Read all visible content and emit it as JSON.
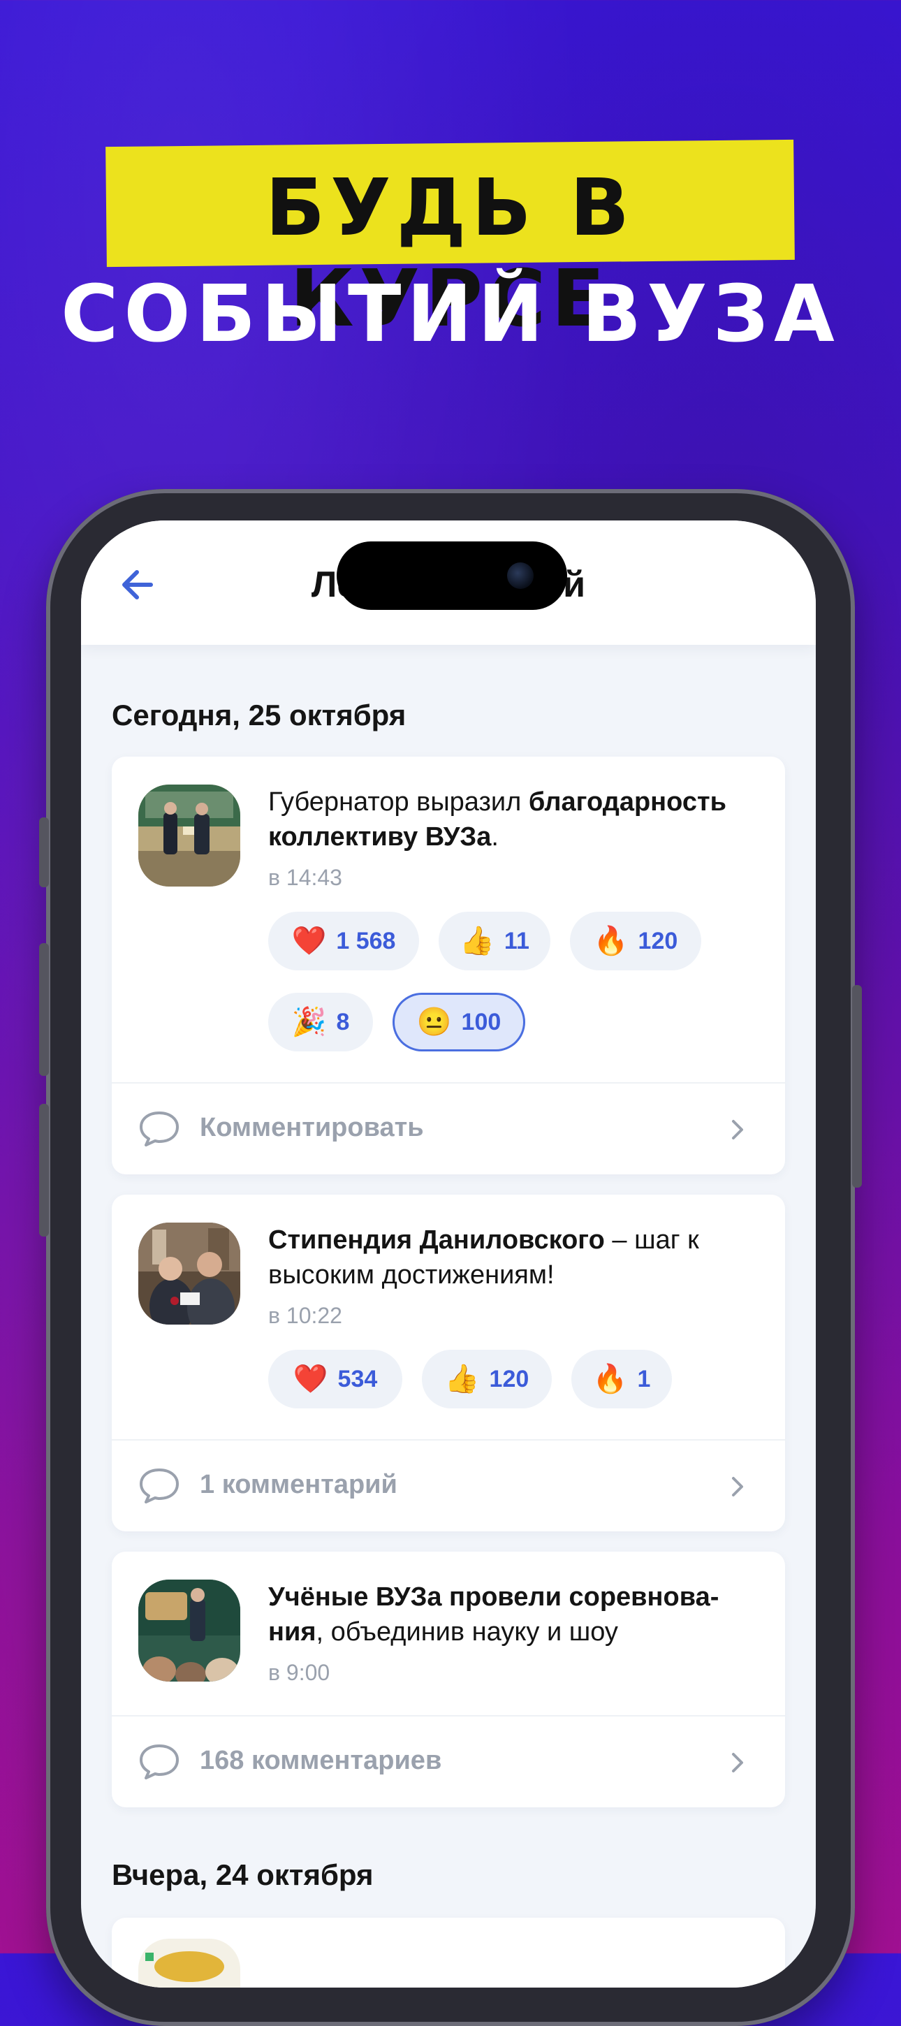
{
  "promo": {
    "line1": "БУДЬ В КУРСЕ",
    "line2": "СОБЫТИЙ ВУЗА",
    "accent": "#ece21d"
  },
  "header": {
    "title": "Лента событий",
    "back_icon": "arrow-left-icon"
  },
  "sections": [
    {
      "date": "Сегодня, 25 октября",
      "items": [
        {
          "title_plain": "Губернатор выразил ",
          "title_bold": "благодарность коллективу ВУЗа",
          "title_tail": ".",
          "time": "в 14:43",
          "reactions": [
            {
              "emoji": "❤️",
              "count": "1 568"
            },
            {
              "emoji": "👍",
              "count": "11"
            },
            {
              "emoji": "🔥",
              "count": "120"
            },
            {
              "emoji": "🎉",
              "count": "8"
            },
            {
              "emoji": "😐",
              "count": "100",
              "selected": true
            }
          ],
          "comment_label": "Комментировать"
        },
        {
          "title_bold": "Стипендия Даниловского",
          "title_tail": " – шаг к высоким достижениям!",
          "time": "в 10:22",
          "reactions": [
            {
              "emoji": "❤️",
              "count": "534"
            },
            {
              "emoji": "👍",
              "count": "120"
            },
            {
              "emoji": "🔥",
              "count": "1"
            }
          ],
          "comment_label": "1 комментарий"
        },
        {
          "title_bold": "Учёные ВУЗа провели соревнова-ния",
          "title_tail": ", объединив науку и шоу",
          "time": "в 9:00",
          "reactions": [],
          "comment_label": "168 комментариев"
        }
      ]
    },
    {
      "date": "Вчера, 24 октября",
      "items": []
    }
  ],
  "colors": {
    "accent_blue": "#3b5bd9",
    "muted": "#9aa1ad"
  }
}
